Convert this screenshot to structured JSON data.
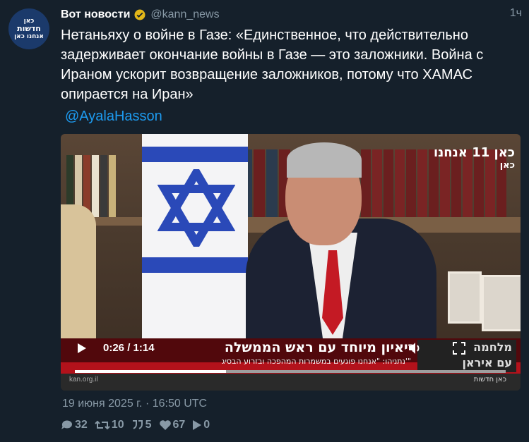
{
  "account": {
    "avatar_lines": [
      "כאן",
      "חדשות",
      "אנחנו כאן"
    ],
    "name": "Вот новости",
    "handle": "@kann_news",
    "age": "1ч"
  },
  "tweet": {
    "text": "Нетаньяху о войне в Газе: «Единственное, что действительно задерживает окончание войны в Газе — это заложники. Война с Ираном ускорит возвращение заложников, потому что ХАМАС опирается на Иран»",
    "mention": "@AyalaHasson",
    "date": "19 июня 2025 г. · 16:50 UTC"
  },
  "video": {
    "channel_logo_top": "כאן 11 אנחנו",
    "channel_logo_sub": "כאן",
    "headline": "ריאיון מיוחד עם ראש הממשלה",
    "subline": "נתניהו: \"אנחנו פוגעים במשמרות המהפכה ובזרוע הבסיג'\"",
    "side_logo_1": "מלחמה",
    "side_logo_2": "עם איראן",
    "timecode": "0:26 / 1:14",
    "progress": 0.351,
    "url": "kan.org.il",
    "bottom_logo": "כאן חדשות"
  },
  "stats": {
    "replies": "32",
    "retweets": "10",
    "quotes": "5",
    "likes": "67",
    "views": "0"
  },
  "colors": {
    "background": "#15202b",
    "accent": "#1d9bf0",
    "muted": "#8899a6",
    "lower_third": "#b3121b"
  }
}
